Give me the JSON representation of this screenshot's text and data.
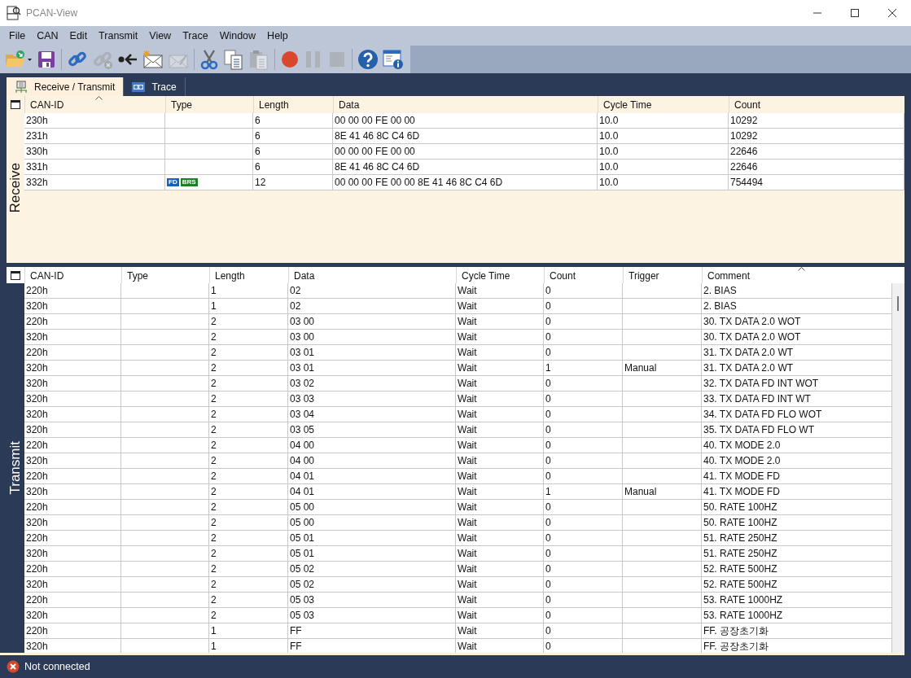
{
  "window": {
    "title": "PCAN-View"
  },
  "menu": [
    "File",
    "CAN",
    "Edit",
    "Transmit",
    "View",
    "Trace",
    "Window",
    "Help"
  ],
  "toolbar": [
    {
      "kind": "open",
      "disabled": false
    },
    {
      "kind": "save",
      "disabled": false
    },
    {
      "kind": "separator"
    },
    {
      "kind": "connect",
      "disabled": false
    },
    {
      "kind": "disconnect",
      "disabled": true
    },
    {
      "kind": "reset",
      "disabled": false
    },
    {
      "kind": "new-message",
      "disabled": false
    },
    {
      "kind": "edit-message",
      "disabled": true
    },
    {
      "kind": "separator"
    },
    {
      "kind": "cut",
      "disabled": false
    },
    {
      "kind": "copy",
      "disabled": false
    },
    {
      "kind": "paste",
      "disabled": true
    },
    {
      "kind": "separator"
    },
    {
      "kind": "record",
      "disabled": false
    },
    {
      "kind": "pause",
      "disabled": true
    },
    {
      "kind": "stop",
      "disabled": true
    },
    {
      "kind": "separator"
    },
    {
      "kind": "help",
      "disabled": false
    },
    {
      "kind": "about",
      "disabled": false
    }
  ],
  "tabs": [
    {
      "label": "Receive / Transmit",
      "kind": "rx",
      "selected": true
    },
    {
      "label": "Trace",
      "kind": "trace",
      "selected": false
    }
  ],
  "receive": {
    "label": "Receive",
    "columns": [
      {
        "label": "CAN-ID",
        "sorted": true
      },
      {
        "label": "Type",
        "sorted": false
      },
      {
        "label": "Length",
        "sorted": false
      },
      {
        "label": "Data",
        "sorted": false
      },
      {
        "label": "Cycle Time",
        "sorted": false
      },
      {
        "label": "Count",
        "sorted": false
      }
    ],
    "rows": [
      {
        "can_id": "230h",
        "type_flags": [],
        "length": "6",
        "data": "00 00 00 FE 00 00",
        "cycle_time": "10.0",
        "count": "10292"
      },
      {
        "can_id": "231h",
        "type_flags": [],
        "length": "6",
        "data": "8E 41 46 8C C4 6D",
        "cycle_time": "10.0",
        "count": "10292"
      },
      {
        "can_id": "330h",
        "type_flags": [],
        "length": "6",
        "data": "00 00 00 FE 00 00",
        "cycle_time": "10.0",
        "count": "22646"
      },
      {
        "can_id": "331h",
        "type_flags": [],
        "length": "6",
        "data": "8E 41 46 8C C4 6D",
        "cycle_time": "10.0",
        "count": "22646"
      },
      {
        "can_id": "332h",
        "type_flags": [
          {
            "label": "FD",
            "color": "#1d5fb5"
          },
          {
            "label": "BRS",
            "color": "#1e7d28"
          }
        ],
        "length": "12",
        "data": "00 00 00 FE 00 00 8E 41 46 8C C4 6D",
        "cycle_time": "10.0",
        "count": "754494"
      }
    ]
  },
  "transmit": {
    "label": "Transmit",
    "columns": [
      {
        "label": "CAN-ID",
        "sorted": false
      },
      {
        "label": "Type",
        "sorted": false
      },
      {
        "label": "Length",
        "sorted": false
      },
      {
        "label": "Data",
        "sorted": false
      },
      {
        "label": "Cycle Time",
        "sorted": false
      },
      {
        "label": "Count",
        "sorted": false
      },
      {
        "label": "Trigger",
        "sorted": false
      },
      {
        "label": "Comment",
        "sorted": true
      }
    ],
    "rows": [
      [
        "220h",
        "",
        "1",
        "02",
        "Wait",
        "0",
        "",
        "2. BIAS"
      ],
      [
        "320h",
        "",
        "1",
        "02",
        "Wait",
        "0",
        "",
        "2. BIAS"
      ],
      [
        "220h",
        "",
        "2",
        "03 00",
        "Wait",
        "0",
        "",
        "30. TX DATA 2.0 WOT"
      ],
      [
        "320h",
        "",
        "2",
        "03 00",
        "Wait",
        "0",
        "",
        "30. TX DATA 2.0 WOT"
      ],
      [
        "220h",
        "",
        "2",
        "03 01",
        "Wait",
        "0",
        "",
        "31. TX DATA 2.0 WT"
      ],
      [
        "320h",
        "",
        "2",
        "03 01",
        "Wait",
        "1",
        "Manual",
        "31. TX DATA 2.0 WT"
      ],
      [
        "320h",
        "",
        "2",
        "03 02",
        "Wait",
        "0",
        "",
        "32. TX DATA FD INT WOT"
      ],
      [
        "320h",
        "",
        "2",
        "03 03",
        "Wait",
        "0",
        "",
        "33. TX DATA FD INT WT"
      ],
      [
        "320h",
        "",
        "2",
        "03 04",
        "Wait",
        "0",
        "",
        "34. TX DATA FD FLO WOT"
      ],
      [
        "320h",
        "",
        "2",
        "03 05",
        "Wait",
        "0",
        "",
        "35. TX DATA FD FLO WT"
      ],
      [
        "220h",
        "",
        "2",
        "04 00",
        "Wait",
        "0",
        "",
        "40. TX MODE 2.0"
      ],
      [
        "320h",
        "",
        "2",
        "04 00",
        "Wait",
        "0",
        "",
        "40. TX MODE 2.0"
      ],
      [
        "220h",
        "",
        "2",
        "04 01",
        "Wait",
        "0",
        "",
        "41. TX MODE FD"
      ],
      [
        "320h",
        "",
        "2",
        "04 01",
        "Wait",
        "1",
        "Manual",
        "41. TX MODE FD"
      ],
      [
        "220h",
        "",
        "2",
        "05 00",
        "Wait",
        "0",
        "",
        "50. RATE 100HZ"
      ],
      [
        "320h",
        "",
        "2",
        "05 00",
        "Wait",
        "0",
        "",
        "50. RATE 100HZ"
      ],
      [
        "220h",
        "",
        "2",
        "05 01",
        "Wait",
        "0",
        "",
        "51. RATE 250HZ"
      ],
      [
        "320h",
        "",
        "2",
        "05 01",
        "Wait",
        "0",
        "",
        "51. RATE 250HZ"
      ],
      [
        "220h",
        "",
        "2",
        "05 02",
        "Wait",
        "0",
        "",
        "52. RATE 500HZ"
      ],
      [
        "320h",
        "",
        "2",
        "05 02",
        "Wait",
        "0",
        "",
        "52. RATE 500HZ"
      ],
      [
        "220h",
        "",
        "2",
        "05 03",
        "Wait",
        "0",
        "",
        "53. RATE 1000HZ"
      ],
      [
        "320h",
        "",
        "2",
        "05 03",
        "Wait",
        "0",
        "",
        "53. RATE 1000HZ"
      ],
      [
        "220h",
        "",
        "1",
        "FF",
        "Wait",
        "0",
        "",
        "FF. 공장초기화"
      ],
      [
        "320h",
        "",
        "1",
        "FF",
        "Wait",
        "0",
        "",
        "FF. 공장초기화"
      ]
    ]
  },
  "status_bar": {
    "text": "Not connected",
    "connected": false
  }
}
